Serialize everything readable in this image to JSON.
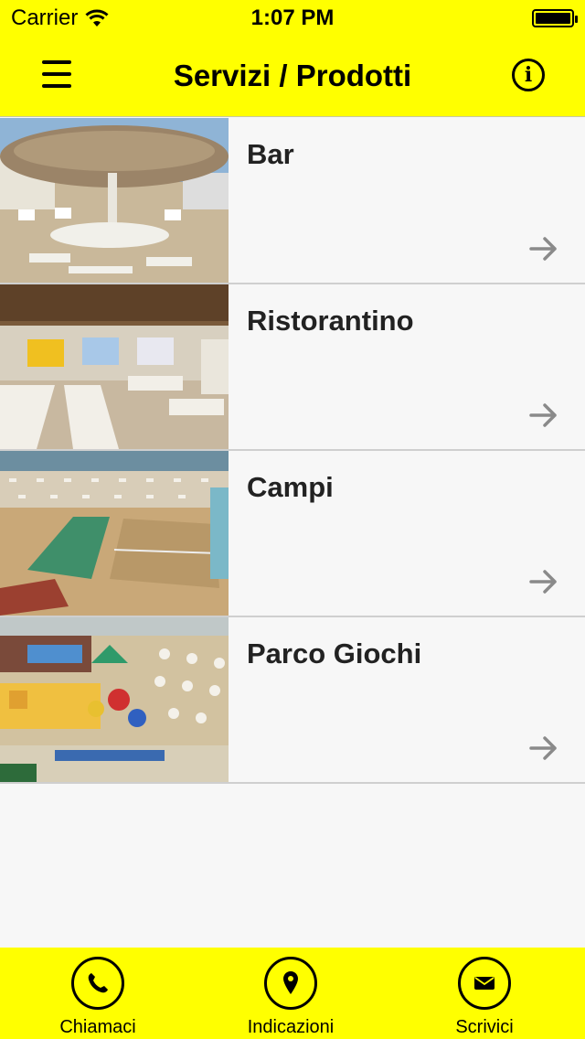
{
  "status_bar": {
    "carrier": "Carrier",
    "time": "1:07 PM"
  },
  "nav": {
    "title": "Servizi / Prodotti"
  },
  "items": [
    {
      "label": "Bar"
    },
    {
      "label": "Ristorantino"
    },
    {
      "label": "Campi"
    },
    {
      "label": "Parco Giochi"
    }
  ],
  "tabs": [
    {
      "label": "Chiamaci",
      "icon": "phone-icon"
    },
    {
      "label": "Indicazioni",
      "icon": "location-pin-icon"
    },
    {
      "label": "Scrivici",
      "icon": "envelope-icon"
    }
  ],
  "colors": {
    "accent": "#ffff00",
    "background": "#f7f7f7",
    "arrow": "#8a8a8a"
  }
}
